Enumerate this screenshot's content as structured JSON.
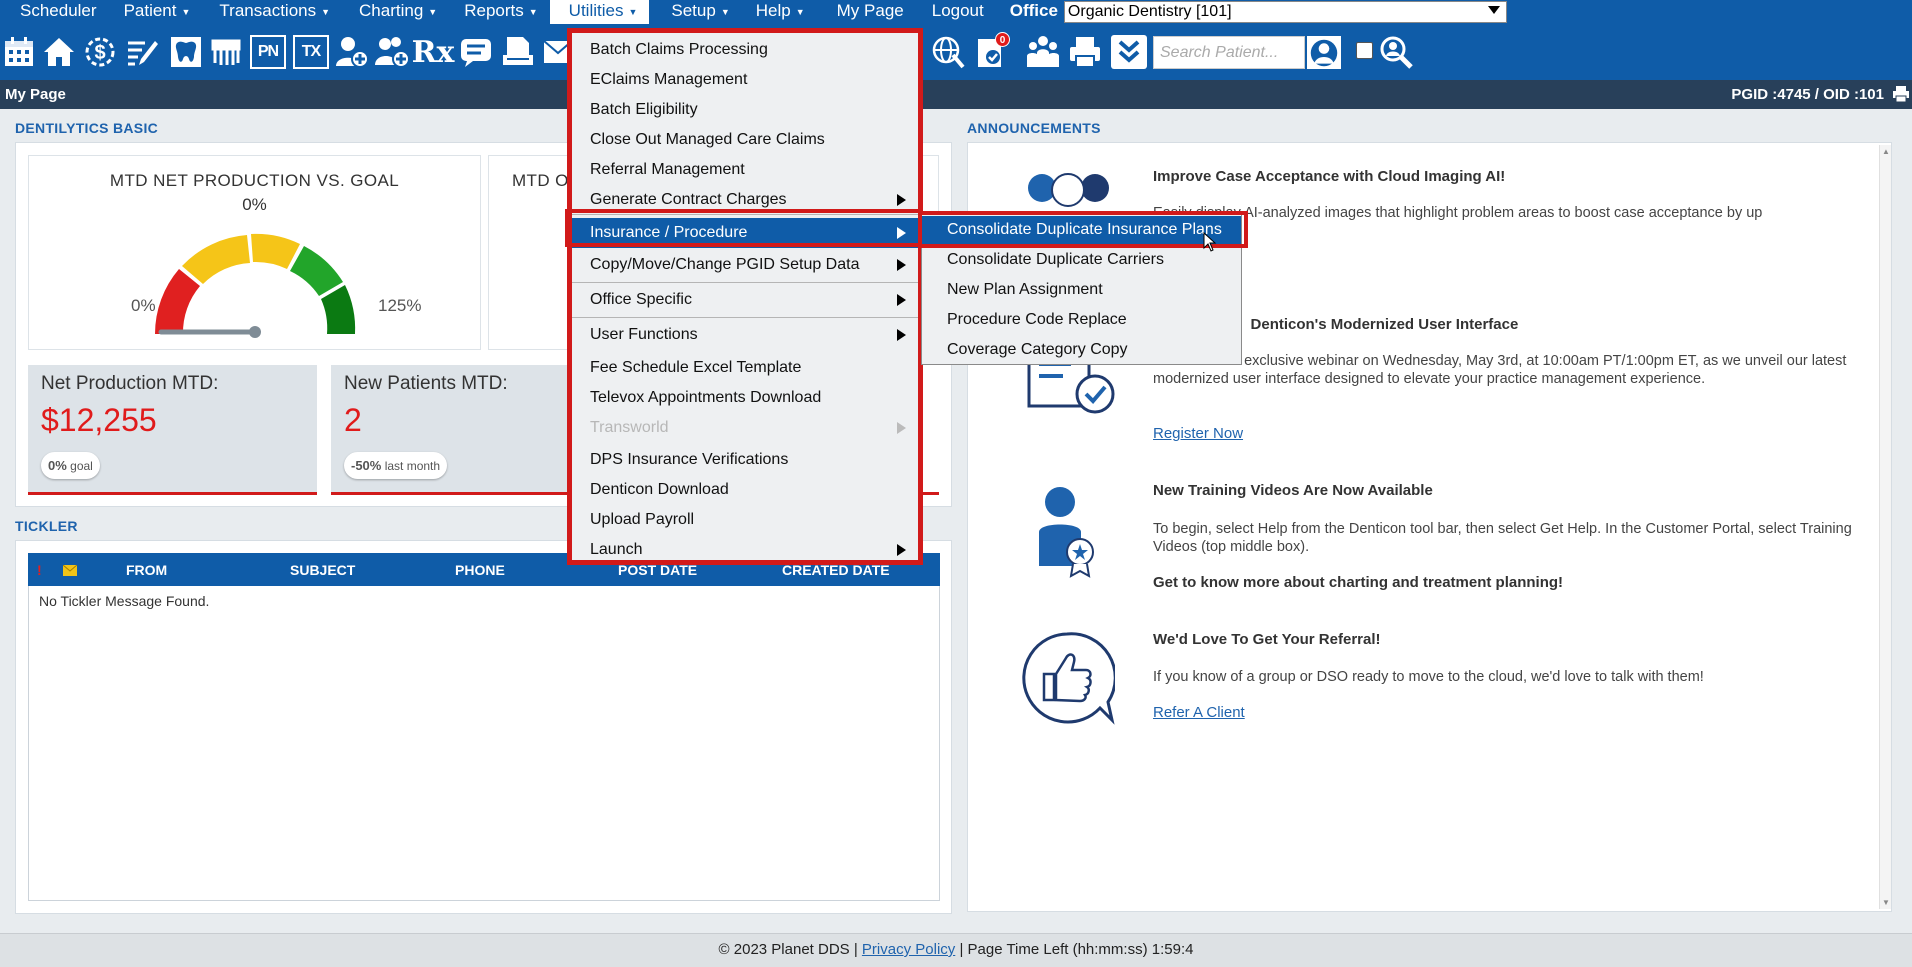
{
  "nav": {
    "items": [
      "Scheduler",
      "Patient",
      "Transactions",
      "Charting",
      "Reports",
      "Utilities",
      "Setup",
      "Help",
      "My Page",
      "Logout"
    ],
    "office_label": "Office",
    "office_value": "Organic Dentistry [101]"
  },
  "toolbar": {
    "icons": [
      "calendar-icon",
      "home-icon",
      "dollar-icon",
      "edit-list-icon",
      "tooth-icon",
      "teeth-icon",
      "pn-icon",
      "tx-icon",
      "add-patient-icon",
      "add-family-icon",
      "rx-icon",
      "message-icon",
      "print-doc-icon",
      "scan-doc-icon",
      "globe-icon",
      "notification-icon",
      "family-icon",
      "printer-icon",
      "expand-icon",
      "search-user-icon",
      "search-group-icon"
    ],
    "pn_label": "PN",
    "tx_label": "TX",
    "rx_label": "Rx",
    "notification_count": "0",
    "search_placeholder": "Search Patient..."
  },
  "page": {
    "title": "My Page",
    "pgid": "PGID :4745  /  OID :101"
  },
  "dashboard": {
    "label": "DENTILYTICS BASIC",
    "gauge1": {
      "title": "MTD NET PRODUCTION VS. GOAL",
      "percent": "0%",
      "min": "0%",
      "max": "125%",
      "value_fraction": 0.0
    },
    "gauge2": {
      "title": "MTD O"
    },
    "kpis": [
      {
        "title": "Net Production MTD:",
        "value": "$12,255",
        "pill_value": "0%",
        "pill_note": "goal"
      },
      {
        "title": "New Patients MTD:",
        "value": "2",
        "pill_value": "-50%",
        "pill_note": "last month"
      }
    ]
  },
  "tickler": {
    "label": "TICKLER",
    "columns": [
      "!",
      "FROM",
      "SUBJECT",
      "PHONE",
      "POST DATE",
      "CREATED DATE"
    ],
    "empty": "No Tickler Message Found."
  },
  "announcements": {
    "label": "ANNOUNCEMENTS",
    "items": [
      {
        "title": "Improve Case Acceptance with Cloud Imaging AI!",
        "text": "Easily display AI-analyzed images that highlight problem areas to boost case acceptance by up"
      },
      {
        "title": "Denticon's Modernized User Interface",
        "text": "Join us for an exclusive webinar on Wednesday, May 3rd, at 10:00am PT/1:00pm ET, as we unveil our latest modernized user interface designed to elevate your practice management experience.",
        "link": "Register Now"
      },
      {
        "title": "New Training Videos Are Now Available",
        "text": "To begin, select Help from the Denticon tool bar, then select Get Help. In the Customer Portal, select Training Videos (top middle box).",
        "subtitle": "Get to know more about charting and treatment planning!"
      },
      {
        "title": "We'd Love To Get Your Referral!",
        "text": "If you know of a group or DSO ready to move to the cloud, we'd love to talk with them!",
        "link": "Refer A Client"
      }
    ]
  },
  "utilities_menu": {
    "items": [
      {
        "label": "Batch Claims Processing"
      },
      {
        "label": "EClaims Management"
      },
      {
        "label": "Batch Eligibility"
      },
      {
        "label": "Close Out Managed Care Claims"
      },
      {
        "label": "Referral Management"
      },
      {
        "label": "Generate Contract Charges"
      },
      {
        "label": "Insurance / Procedure"
      },
      {
        "label": "Copy/Move/Change PGID Setup Data"
      },
      {
        "label": "Office Specific"
      },
      {
        "label": "User Functions"
      },
      {
        "label": "Fee Schedule Excel Template"
      },
      {
        "label": "Televox Appointments Download"
      },
      {
        "label": "Transworld"
      },
      {
        "label": "DPS Insurance Verifications"
      },
      {
        "label": "Denticon Download"
      },
      {
        "label": "Upload Payroll"
      },
      {
        "label": "Launch"
      }
    ]
  },
  "insurance_submenu": {
    "items": [
      {
        "label": "Consolidate Duplicate Insurance Plans"
      },
      {
        "label": "Consolidate Duplicate Carriers"
      },
      {
        "label": "New Plan Assignment"
      },
      {
        "label": "Procedure Code Replace"
      },
      {
        "label": "Coverage Category Copy"
      }
    ]
  },
  "footer": {
    "copyright": "© 2023 Planet DDS |",
    "privacy": "Privacy Policy",
    "time_left": "|  Page Time Left (hh:mm:ss) 1:59:4"
  },
  "colors": {
    "nav": "#0f5ca8",
    "header": "#28405a",
    "accent_red": "#d11a1a",
    "link": "#1f63ad"
  }
}
